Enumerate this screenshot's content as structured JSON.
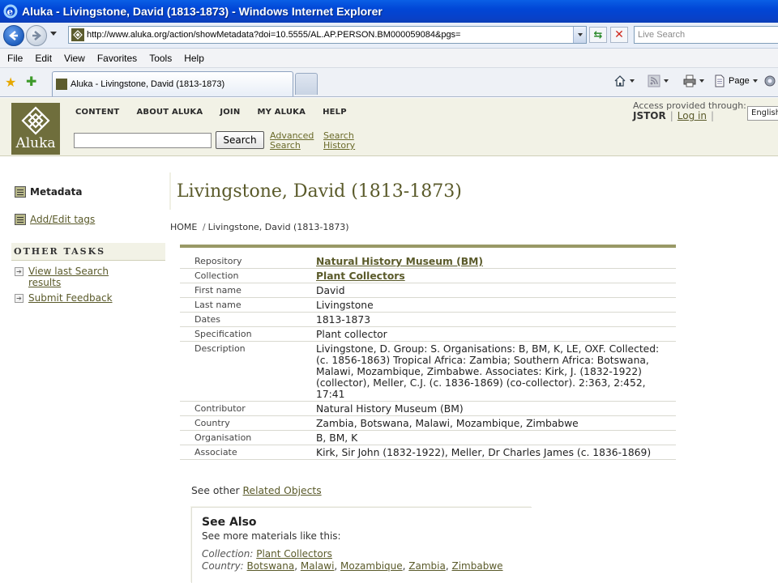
{
  "window": {
    "title": "Aluka - Livingstone, David (1813-1873) - Windows Internet Explorer"
  },
  "address_bar": {
    "url": "http://www.aluka.org/action/showMetadata?doi=10.5555/AL.AP.PERSON.BM000059084&pgs=",
    "search_placeholder": "Live Search"
  },
  "menu": [
    "File",
    "Edit",
    "View",
    "Favorites",
    "Tools",
    "Help"
  ],
  "tab": {
    "title": "Aluka - Livingstone, David (1813-1873)"
  },
  "toolbar": {
    "page_label": "Page"
  },
  "site": {
    "logo_text": "Aluka",
    "nav": [
      "CONTENT",
      "ABOUT ALUKA",
      "JOIN",
      "MY ALUKA",
      "HELP"
    ],
    "access_label": "Access provided through:",
    "provider": "JSTOR",
    "login": "Log in",
    "language": "English",
    "search_button": "Search",
    "advanced_search": [
      "Advanced",
      "Search"
    ],
    "search_history": [
      "Search",
      "History"
    ]
  },
  "sidebar": {
    "metadata": "Metadata",
    "add_edit_tags": "Add/Edit tags",
    "other_tasks": "Other Tasks",
    "tasks": [
      [
        "View last Search",
        "results"
      ],
      [
        "Submit Feedback"
      ]
    ]
  },
  "main": {
    "title": "Livingstone, David (1813-1873)",
    "breadcrumb": {
      "home": "HOME",
      "sep": "/",
      "current": "Livingstone, David (1813-1873)"
    },
    "rows": [
      {
        "key": "Repository",
        "value": "Natural History Museum (BM)",
        "link": true
      },
      {
        "key": "Collection",
        "value": "Plant Collectors",
        "link": true
      },
      {
        "key": "First name",
        "value": "David"
      },
      {
        "key": "Last name",
        "value": "Livingstone"
      },
      {
        "key": "Dates",
        "value": "1813-1873"
      },
      {
        "key": "Specification",
        "value": "Plant collector"
      },
      {
        "key": "Description",
        "value": "Livingstone, D. Group: S. Organisations: B, BM, K, LE, OXF. Collected: (c. 1856-1863) Tropical Africa: Zambia; Southern Africa: Botswana, Malawi, Mozambique, Zimbabwe. Associates: Kirk, J. (1832-1922) (collector), Meller, C.J. (c. 1836-1869) (co-collector). 2:363, 2:452, 17:41"
      },
      {
        "key": "Contributor",
        "value": "Natural History Museum (BM)"
      },
      {
        "key": "Country",
        "value": "Zambia, Botswana, Malawi, Mozambique, Zimbabwe"
      },
      {
        "key": "Organisation",
        "value": "B, BM, K"
      },
      {
        "key": "Associate",
        "value": "Kirk, Sir John (1832-1922), Meller, Dr Charles James (c. 1836-1869)"
      }
    ],
    "related_prefix": "See other",
    "related_link": "Related Objects",
    "see_also": {
      "title": "See Also",
      "subtitle": "See more materials like this:",
      "collection_label": "Collection:",
      "collection_value": "Plant Collectors",
      "country_label": "Country:",
      "countries": [
        "Botswana",
        "Malawi",
        "Mozambique",
        "Zambia",
        "Zimbabwe"
      ]
    }
  },
  "colors": {
    "brand_olive": "#6f6e3c",
    "link_olive": "#5a5a2a",
    "ie_blue": "#0146d6"
  }
}
